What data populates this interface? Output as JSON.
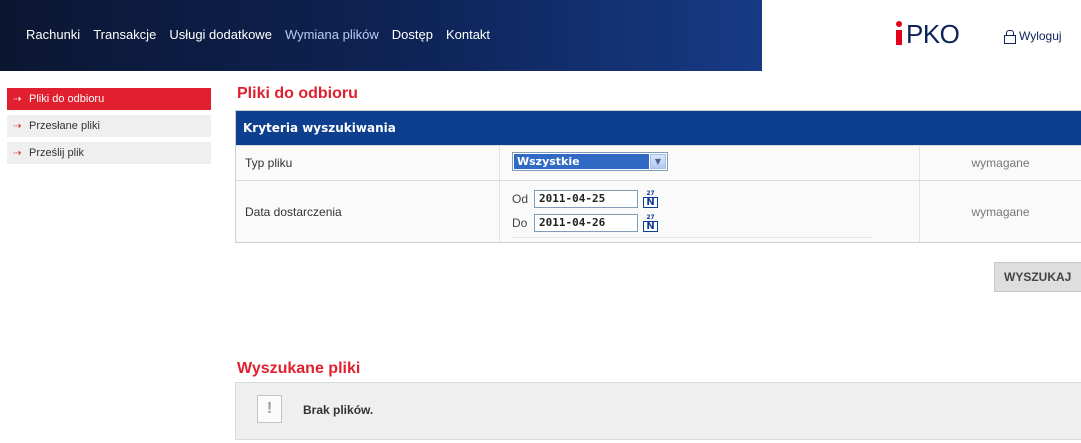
{
  "nav": {
    "items": [
      {
        "label": "Rachunki",
        "active": false
      },
      {
        "label": "Transakcje",
        "active": false
      },
      {
        "label": "Usługi dodatkowe",
        "active": false
      },
      {
        "label": "Wymiana plików",
        "active": true
      },
      {
        "label": "Dostęp",
        "active": false
      },
      {
        "label": "Kontakt",
        "active": false
      }
    ],
    "logo_text": "PKO",
    "logout_label": "Wyloguj"
  },
  "sidebar": {
    "items": [
      {
        "label": "Pliki do odbioru",
        "active": true
      },
      {
        "label": "Przesłane pliki",
        "active": false
      },
      {
        "label": "Prześlij plik",
        "active": false
      }
    ]
  },
  "main": {
    "title": "Pliki do odbioru",
    "criteria_header": "Kryteria wyszukiwania",
    "file_type": {
      "label": "Typ pliku",
      "value": "Wszystkie",
      "required": "wymagane"
    },
    "delivery_date": {
      "label": "Data dostarczenia",
      "from_label": "Od",
      "from_value": "2011-04-25",
      "to_label": "Do",
      "to_value": "2011-04-26",
      "required": "wymagane"
    },
    "search_button": "WYSZUKAJ",
    "results_title": "Wyszukane pliki",
    "empty_message": "Brak plików."
  },
  "colors": {
    "accent_red": "#e0202e",
    "header_blue": "#0e3f8f",
    "nav_dark": "#0d2358"
  }
}
